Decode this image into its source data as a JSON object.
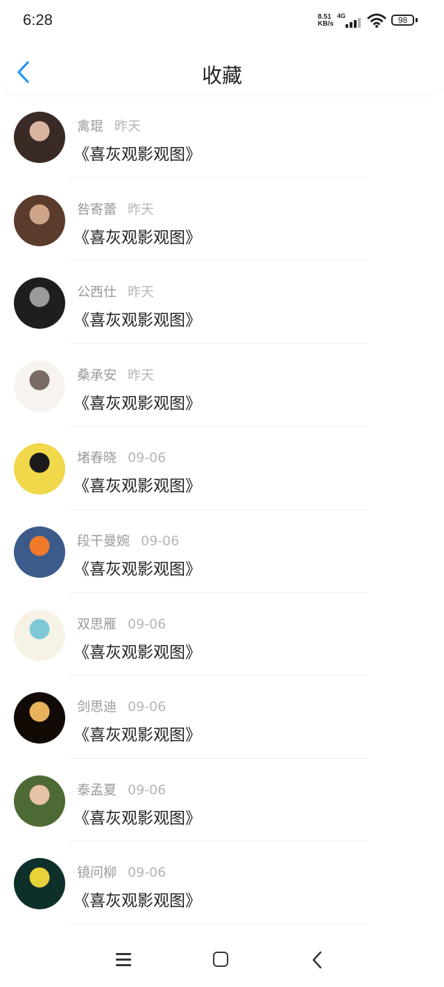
{
  "status_bar": {
    "time": "6:28",
    "net_speed_value": "8.51",
    "net_speed_unit": "KB/s",
    "network": "4G",
    "battery": "98"
  },
  "header": {
    "title": "收藏",
    "back_icon": "chevron-left-icon",
    "accent_color": "#2196F3"
  },
  "favorites": [
    {
      "user": "禽琨",
      "date": "昨天",
      "title": "《喜灰观影观图》",
      "avatar_colors": [
        "#3a2a25",
        "#d9b4a0"
      ]
    },
    {
      "user": "咎寄蕾",
      "date": "昨天",
      "title": "《喜灰观影观图》",
      "avatar_colors": [
        "#5a3b2c",
        "#cfa58a"
      ]
    },
    {
      "user": "公西仕",
      "date": "昨天",
      "title": "《喜灰观影观图》",
      "avatar_colors": [
        "#1e1e1e",
        "#9a9a9a"
      ]
    },
    {
      "user": "桑承安",
      "date": "昨天",
      "title": "《喜灰观影观图》",
      "avatar_colors": [
        "#f7f4f0",
        "#7a6a66"
      ]
    },
    {
      "user": "堵春晓",
      "date": "09-06",
      "title": "《喜灰观影观图》",
      "avatar_colors": [
        "#f0d84a",
        "#1a1a1a"
      ]
    },
    {
      "user": "段干曼婉",
      "date": "09-06",
      "title": "《喜灰观影观图》",
      "avatar_colors": [
        "#3c5a8a",
        "#f07a2a"
      ]
    },
    {
      "user": "双思雁",
      "date": "09-06",
      "title": "《喜灰观影观图》",
      "avatar_colors": [
        "#f6f2e6",
        "#7fc8d8"
      ]
    },
    {
      "user": "剑思迪",
      "date": "09-06",
      "title": "《喜灰观影观图》",
      "avatar_colors": [
        "#120a05",
        "#e8b25a"
      ]
    },
    {
      "user": "泰孟夏",
      "date": "09-06",
      "title": "《喜灰观影观图》",
      "avatar_colors": [
        "#4e6a34",
        "#e6c3a6"
      ]
    },
    {
      "user": "镜问柳",
      "date": "09-06",
      "title": "《喜灰观影观图》",
      "avatar_colors": [
        "#0f2f2a",
        "#e8d23a"
      ]
    }
  ],
  "nav_bar": {
    "menu_icon": "menu-icon",
    "home_icon": "home-square-icon",
    "back_icon": "back-triangle-icon"
  }
}
